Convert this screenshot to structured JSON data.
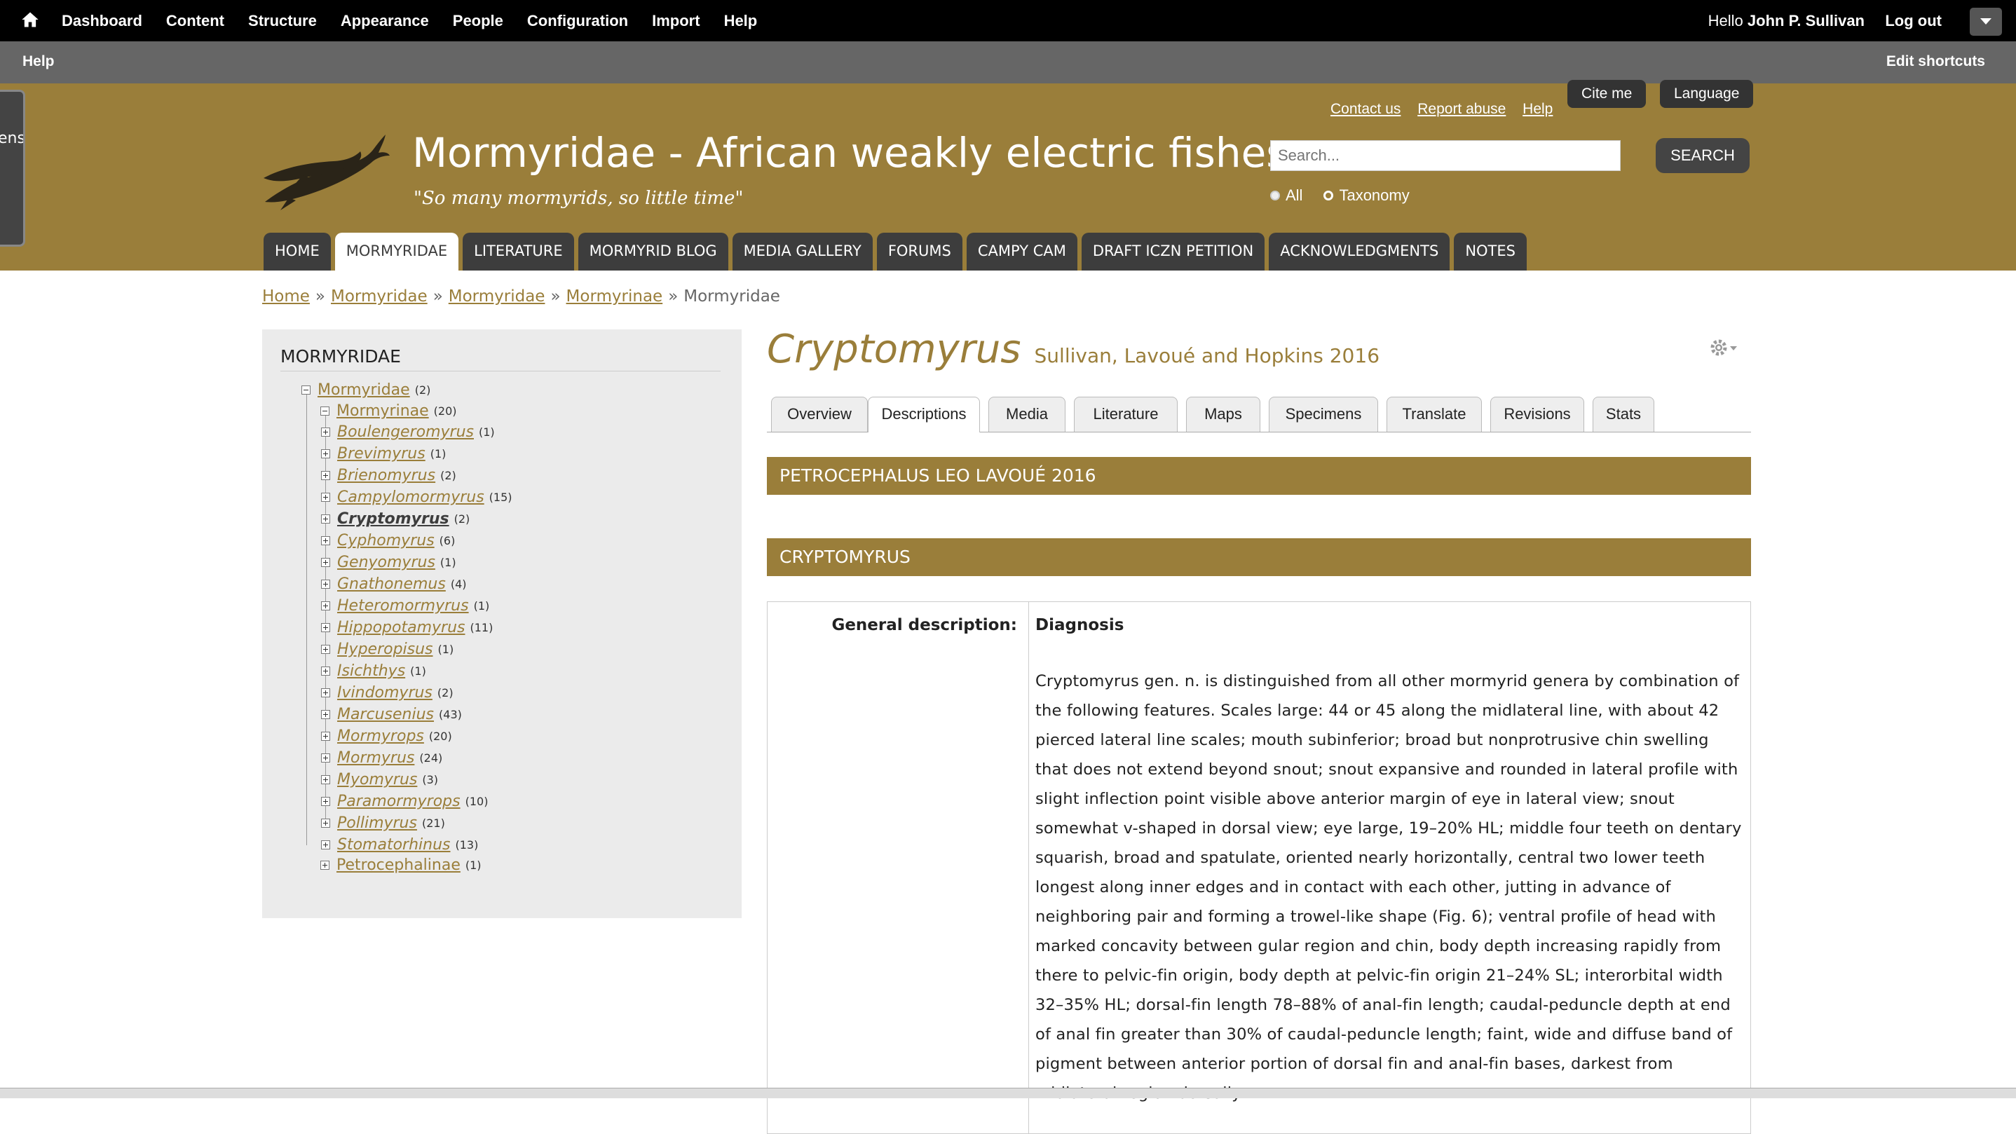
{
  "admin_toolbar": {
    "menu": [
      "Dashboard",
      "Content",
      "Structure",
      "Appearance",
      "People",
      "Configuration",
      "Import",
      "Help"
    ],
    "hello_label": "Hello",
    "user_name": "John P. Sullivan",
    "logout": "Log out"
  },
  "shortcuts": {
    "help": "Help",
    "edit": "Edit shortcuts"
  },
  "header": {
    "left_tab_text": "ens",
    "top_links": [
      "Contact us",
      "Report abuse",
      "Help"
    ],
    "cite": "Cite me",
    "language": "Language",
    "site_name": "Mormyridae - African weakly electric fishes",
    "slogan": "\"So many mormyrids, so little time\"",
    "search_placeholder": "Search...",
    "search_button": "SEARCH",
    "scope_all": "All",
    "scope_taxonomy": "Taxonomy",
    "nav": [
      "HOME",
      "MORMYRIDAE",
      "LITERATURE",
      "MORMYRID BLOG",
      "MEDIA GALLERY",
      "FORUMS",
      "CAMPY CAM",
      "DRAFT ICZN PETITION",
      "ACKNOWLEDGMENTS",
      "NOTES"
    ],
    "nav_active": "MORMYRIDAE"
  },
  "breadcrumb": {
    "links": [
      "Home",
      "Mormyridae",
      "Mormyridae",
      "Mormyrinae"
    ],
    "current": "Mormyridae",
    "separator": "»"
  },
  "sidebar": {
    "title": "MORMYRIDAE",
    "root": {
      "label": "Mormyridae",
      "count": "(2)"
    },
    "subfamily": {
      "label": "Mormyrinae",
      "count": "(20)"
    },
    "genera": [
      {
        "label": "Boulengeromyrus",
        "count": "(1)"
      },
      {
        "label": "Brevimyrus",
        "count": "(1)"
      },
      {
        "label": "Brienomyrus",
        "count": "(2)"
      },
      {
        "label": "Campylomormyrus",
        "count": "(15)"
      },
      {
        "label": "Cryptomyrus",
        "count": "(2)"
      },
      {
        "label": "Cyphomyrus",
        "count": "(6)"
      },
      {
        "label": "Genyomyrus",
        "count": "(1)"
      },
      {
        "label": "Gnathonemus",
        "count": "(4)"
      },
      {
        "label": "Heteromormyrus",
        "count": "(1)"
      },
      {
        "label": "Hippopotamyrus",
        "count": "(11)"
      },
      {
        "label": "Hyperopisus",
        "count": "(1)"
      },
      {
        "label": "Isichthys",
        "count": "(1)"
      },
      {
        "label": "Ivindomyrus",
        "count": "(2)"
      },
      {
        "label": "Marcusenius",
        "count": "(43)"
      },
      {
        "label": "Mormyrops",
        "count": "(20)"
      },
      {
        "label": "Mormyrus",
        "count": "(24)"
      },
      {
        "label": "Myomyrus",
        "count": "(3)"
      },
      {
        "label": "Paramormyrops",
        "count": "(10)"
      },
      {
        "label": "Pollimyrus",
        "count": "(21)"
      },
      {
        "label": "Stomatorhinus",
        "count": "(13)"
      }
    ],
    "current_genus": "Cryptomyrus",
    "other_subfamily": {
      "label": "Petrocephalinae",
      "count": "(1)"
    }
  },
  "content": {
    "title": "Cryptomyrus",
    "authority": "Sullivan, Lavoué and Hopkins 2016",
    "tabs": [
      "Overview",
      "Descriptions",
      "Media",
      "Literature",
      "Maps",
      "Specimens",
      "Translate",
      "Revisions",
      "Stats"
    ],
    "active_tab": "Descriptions",
    "section1": "PETROCEPHALUS LEO LAVOUÉ 2016",
    "section2": "CRYPTOMYRUS",
    "field_label": "General description:",
    "diagnosis_heading": "Diagnosis",
    "diagnosis_text": "Cryptomyrus gen. n. is distinguished from all other mormyrid genera by combination of the following features. Scales large: 44 or 45 along the midlateral line, with about 42 pierced lateral line scales; mouth subinferior; broad but nonprotrusive chin swelling that does not extend beyond snout; snout expansive and rounded in lateral profile with slight inflection point visible above anterior margin of eye in lateral view; snout somewhat v-shaped in dorsal view; eye large, 19–20% HL; middle four teeth on dentary squarish, broad and spatulate, oriented nearly horizontally, central two lower teeth longest along inner edges and in contact with each other, jutting in advance of neighboring pair and forming a trowel-like shape (Fig. 6); ventral profile of head with marked concavity between gular region and chin, body depth increasing rapidly from there to pelvic-fin origin, body depth at pelvic-fin origin 21–24% SL; interorbital width 32–35% HL; dorsal-fin length 78–88% of anal-fin length; caudal-peduncle depth at end of anal fin greater than 30% of caudal-peduncle length; faint, wide and diffuse band of pigment between anterior portion of dorsal fin and anal-fin bases, darkest from midlateral region dorsally."
  },
  "colors": {
    "brand": "#9a7e3a",
    "dark": "#3d3d3d",
    "toolbar": "#000000",
    "shortcut_bar": "#666666"
  }
}
